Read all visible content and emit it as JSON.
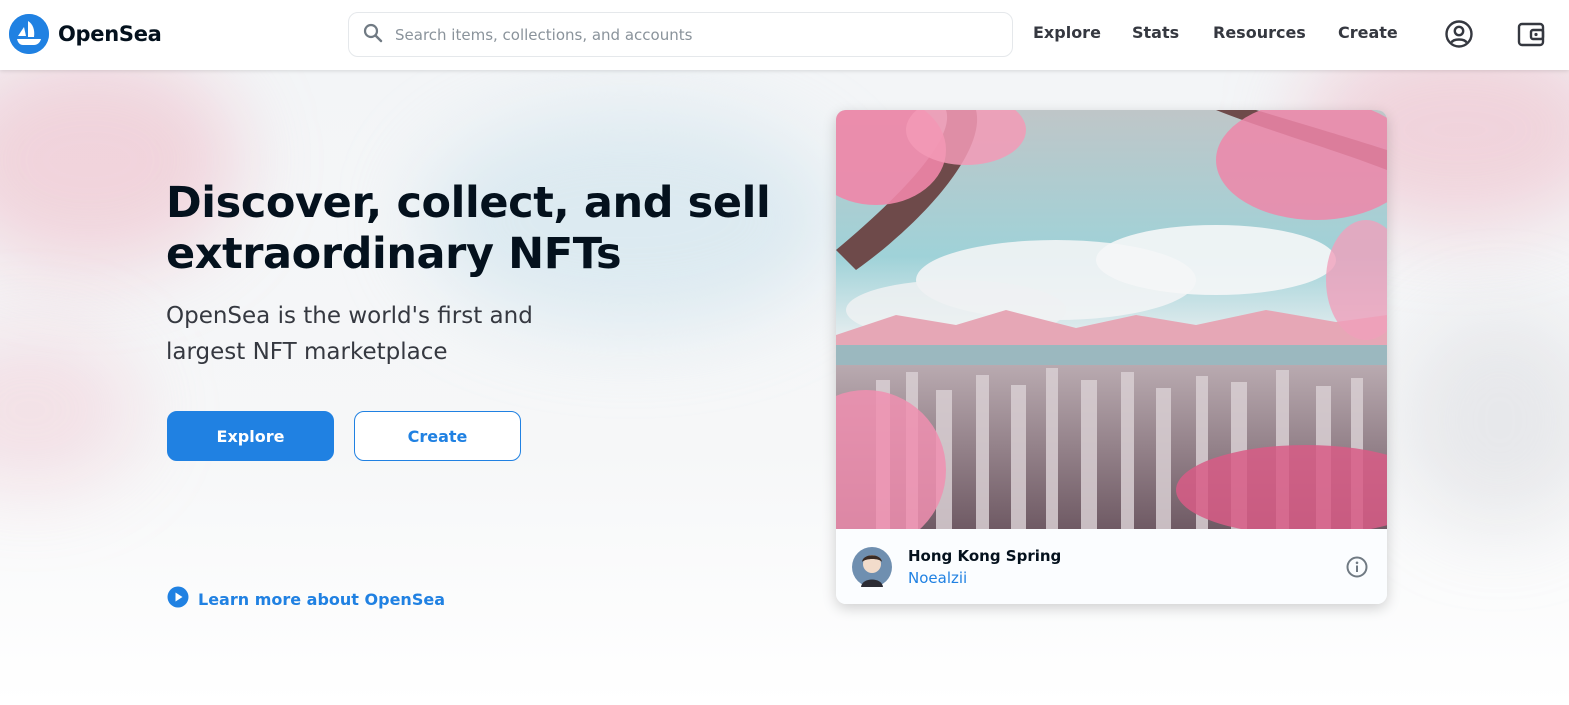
{
  "brand": {
    "name": "OpenSea",
    "icon": "opensea-ship-icon",
    "color": "#2081e2"
  },
  "search": {
    "placeholder": "Search items, collections, and accounts",
    "value": "",
    "icon": "search-icon"
  },
  "nav": {
    "links": [
      "Explore",
      "Stats",
      "Resources",
      "Create"
    ],
    "profile_icon": "account-circle-icon",
    "wallet_icon": "wallet-icon"
  },
  "hero": {
    "title": "Discover, collect, and sell extraordinary NFTs",
    "subtitle": "OpenSea is the world's first and largest NFT marketplace",
    "primary_button": "Explore",
    "secondary_button": "Create",
    "learn_more": "Learn more about OpenSea",
    "learn_more_icon": "play-circle-icon"
  },
  "featured": {
    "title": "Hong Kong Spring",
    "creator": "Noealzii",
    "avatar_icon": "creator-avatar",
    "info_icon": "info-icon"
  }
}
